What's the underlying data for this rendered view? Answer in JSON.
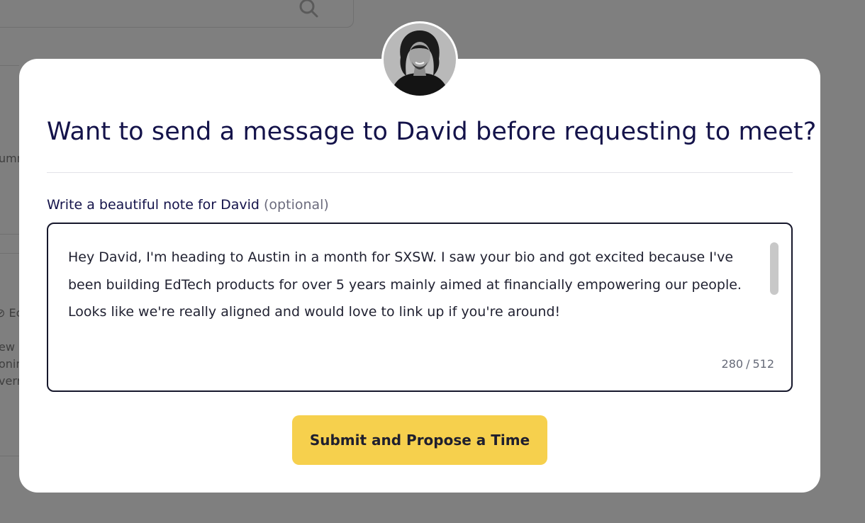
{
  "background": {
    "fragments": [
      "umm",
      "⊘ Ec",
      "ew",
      "onin",
      "verr"
    ]
  },
  "modal": {
    "avatar_icon": "person-avatar-photo",
    "title": "Want to send a message to David before requesting to meet?",
    "note_label": "Write a beautiful note for David",
    "note_label_optional": "(optional)",
    "note_text": "Hey David, I'm heading to Austin in a month for SXSW. I saw your bio and got excited because I've been building EdTech products for over 5 years mainly aimed at financially empowering our people. Looks like we're really aligned and would love to link up if you're around!",
    "char_count": "280",
    "char_limit": "512",
    "submit_label": "Submit and Propose a Time"
  },
  "colors": {
    "overlay": "#7f7f7f",
    "title": "#14134a",
    "button": "#f6d04d"
  }
}
